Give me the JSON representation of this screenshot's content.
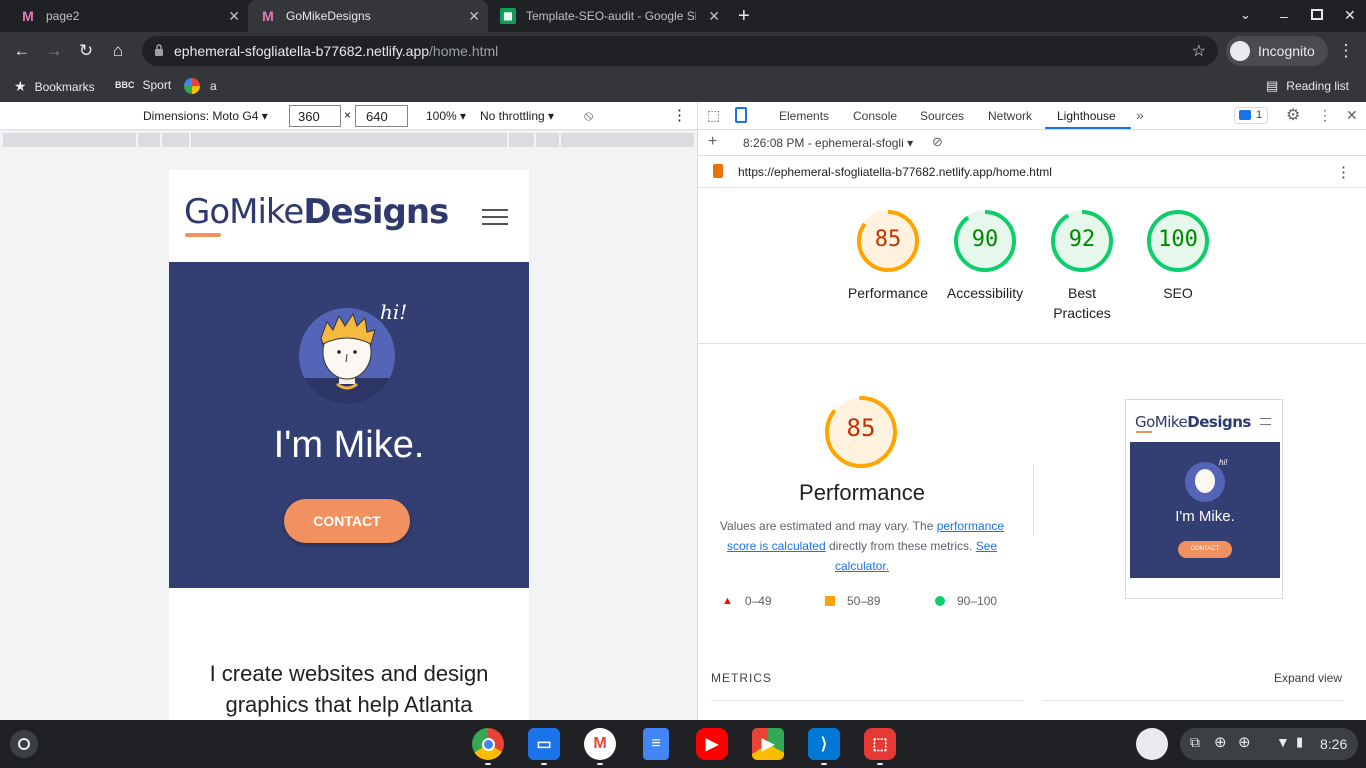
{
  "browser": {
    "tabs": [
      {
        "title": "page2",
        "active": false
      },
      {
        "title": "GoMikeDesigns",
        "active": true
      },
      {
        "title": "Template-SEO-audit - Google Sheets",
        "active": false
      }
    ],
    "url_host": "ephemeral-sfogliatella-b77682.netlify.app",
    "url_path": "/home.html",
    "incognito_label": "Incognito",
    "bookmarks": [
      "Bookmarks",
      "Sport",
      "a"
    ],
    "reading_list": "Reading list"
  },
  "device_toolbar": {
    "dimensions_label": "Dimensions: Moto G4",
    "width": "360",
    "height": "640",
    "times": "×",
    "zoom": "100%",
    "throttling": "No throttling"
  },
  "site": {
    "logo_go": "GoMike",
    "logo_designs": "Designs",
    "hi": "hi!",
    "hero_title": "I'm Mike.",
    "contact_label": "CONTACT",
    "tagline": "I create websites and design graphics that help Atlanta"
  },
  "devtools": {
    "tabs": [
      "Elements",
      "Console",
      "Sources",
      "Network",
      "Lighthouse"
    ],
    "issues_count": "1",
    "report_time": "8:26:08 PM - ephemeral-sfogli",
    "report_url": "https://ephemeral-sfogliatella-b77682.netlify.app/home.html",
    "scores": [
      {
        "label": "Performance",
        "value": "85",
        "color": "#ffa400",
        "text_color": "#c33300",
        "fill": "#fff3e0"
      },
      {
        "label": "Accessibility",
        "value": "90",
        "color": "#0cce6b",
        "text_color": "#008800",
        "fill": "#e6f8ec"
      },
      {
        "label": "Best Practices",
        "value": "92",
        "color": "#0cce6b",
        "text_color": "#008800",
        "fill": "#e6f8ec"
      },
      {
        "label": "SEO",
        "value": "100",
        "color": "#0cce6b",
        "text_color": "#008800",
        "fill": "#e6f8ec"
      }
    ],
    "perf_title": "Performance",
    "perf_desc_1": "Values are estimated and may vary. The ",
    "perf_desc_link1": "performance score is calculated",
    "perf_desc_2": " directly from these metrics. ",
    "perf_desc_link2": "See calculator.",
    "legend": [
      "0–49",
      "50–89",
      "90–100"
    ],
    "thumb_title": "I'm Mike.",
    "thumb_btn": "CONTACT",
    "thumb_hi": "hi!",
    "metrics_title": "METRICS",
    "expand_view": "Expand view"
  },
  "shelf": {
    "time": "8:26",
    "apps": [
      "chrome",
      "files",
      "gmail",
      "docs",
      "youtube",
      "play-store",
      "vscode",
      "screenshot"
    ]
  }
}
